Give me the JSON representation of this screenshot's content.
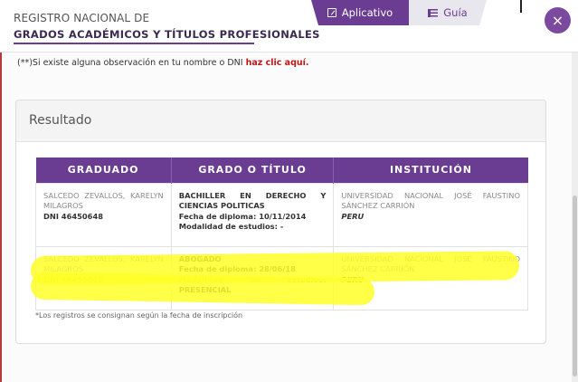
{
  "header": {
    "registry_name": "REGISTRO NACIONAL DE",
    "registry_subtitle": "GRADOS ACADÉMICOS Y TÍTULOS PROFESIONALES",
    "tabs": [
      {
        "label": "Aplicativo",
        "icon": "edit-icon",
        "active": true
      },
      {
        "label": "Guía",
        "icon": "list-icon",
        "active": false
      }
    ],
    "close_label": "×"
  },
  "observation": {
    "prefix": "(**)Si existe alguna observación en tu nombre o DNI ",
    "link": "haz clic aquí."
  },
  "result": {
    "title": "Resultado",
    "columns": [
      "GRADUADO",
      "GRADO O TÍTULO",
      "INSTITUCIÓN"
    ],
    "rows": [
      {
        "name": "SALCEDO ZEVALLOS, KARELYN MILAGROS",
        "dni": "DNI 46450648",
        "degree": "BACHILLER EN DERECHO Y CIENCIAS POLITICAS",
        "diploma_date": "Fecha de diploma: 10/11/2014",
        "modality": "Modalidad de estudios: -",
        "institution": "UNIVERSIDAD NACIONAL JOSÉ FAUSTINO SÁNCHEZ CARRIÓN",
        "country": "PERU"
      },
      {
        "name": "SALCEDO ZEVALLOS, KARELYN MILAGROS",
        "dni": "DNI 46450648",
        "degree": "ABOGADO",
        "diploma_date": "Fecha de diploma: 28/06/18",
        "modality": "Modalidad de estudios: PRESENCIAL",
        "institution": "UNIVERSIDAD NACIONAL JOSÉ FAUSTINO SÁNCHEZ CARRIÓN",
        "country": "PERU"
      }
    ],
    "footnote": "*Los registros se consignan según la fecha de inscripción"
  },
  "colors": {
    "brand_purple": "#6a3c92",
    "link_red": "#c0171a",
    "highlighter": "#ffff28"
  }
}
